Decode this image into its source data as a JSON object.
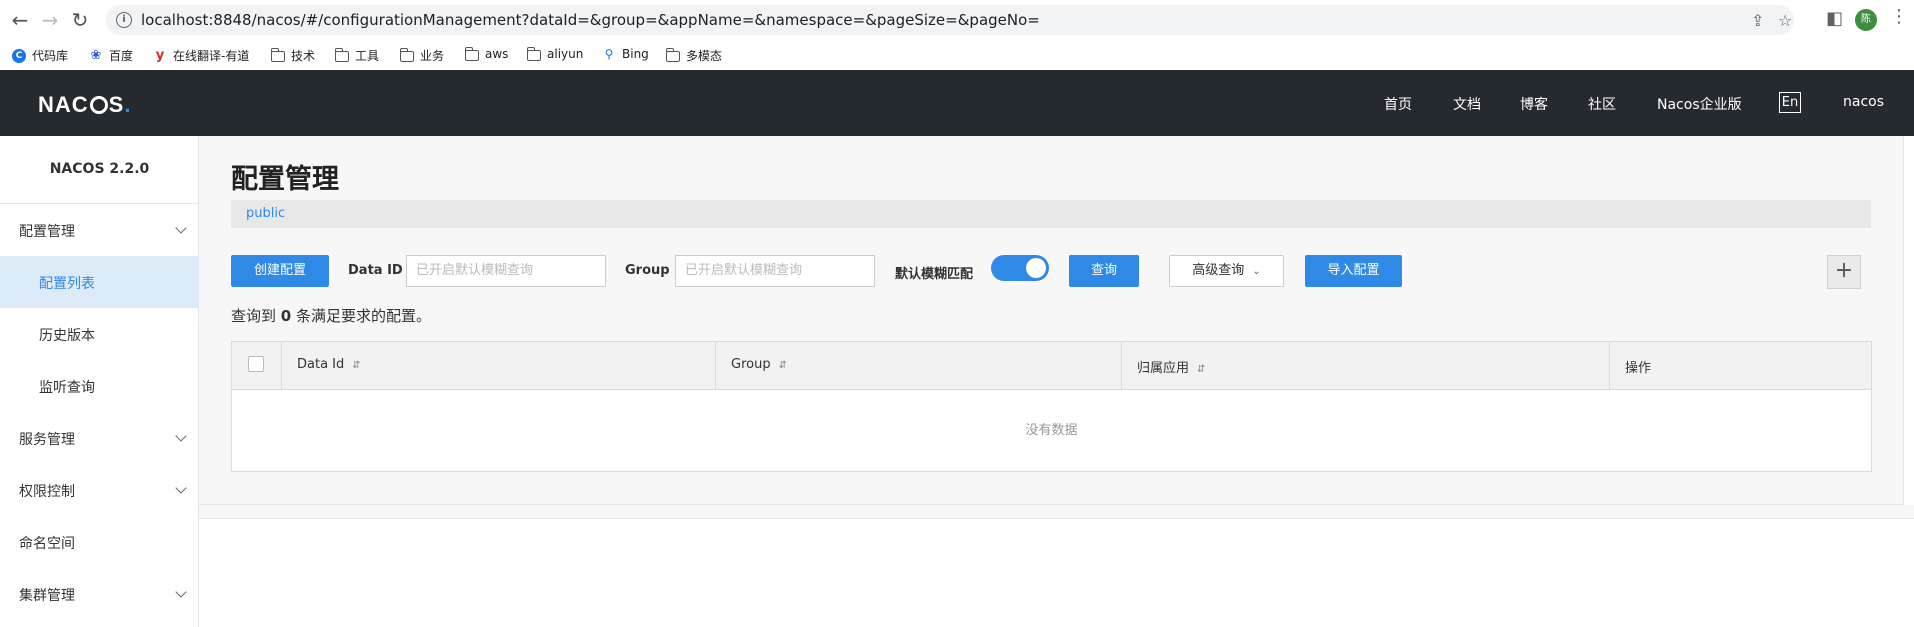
{
  "browser": {
    "url_host": "localhost",
    "url_rest": ":8848/nacos/#/configurationManagement?dataId=&group=&appName=&namespace=&pageSize=&pageNo=",
    "avatar_text": "陈",
    "bookmarks": [
      {
        "icon": "c-icon",
        "label": "代码库"
      },
      {
        "icon": "paw-icon",
        "label": "百度"
      },
      {
        "icon": "y-icon",
        "label": "在线翻译-有道"
      },
      {
        "icon": "folder-icon",
        "label": "技术"
      },
      {
        "icon": "folder-icon",
        "label": "工具"
      },
      {
        "icon": "folder-icon",
        "label": "业务"
      },
      {
        "icon": "folder-icon",
        "label": "aws"
      },
      {
        "icon": "folder-icon",
        "label": "aliyun"
      },
      {
        "icon": "search-icon",
        "label": "Bing"
      },
      {
        "icon": "folder-icon",
        "label": "多模态"
      }
    ]
  },
  "header": {
    "logo": "NACOS.",
    "nav": [
      "首页",
      "文档",
      "博客",
      "社区",
      "Nacos企业版"
    ],
    "lang": "En",
    "user": "nacos"
  },
  "sidebar": {
    "version": "NACOS 2.2.0",
    "items": [
      {
        "label": "配置管理",
        "expandable": true
      },
      {
        "label": "配置列表",
        "sub": true,
        "active": true
      },
      {
        "label": "历史版本",
        "sub": true
      },
      {
        "label": "监听查询",
        "sub": true
      },
      {
        "label": "服务管理",
        "expandable": true
      },
      {
        "label": "权限控制",
        "expandable": true
      },
      {
        "label": "命名空间"
      },
      {
        "label": "集群管理",
        "expandable": true
      }
    ]
  },
  "main": {
    "title": "配置管理",
    "namespace": "public",
    "create_button": "创建配置",
    "dataid_label": "Data ID",
    "dataid_placeholder": "已开启默认模糊查询",
    "group_label": "Group",
    "group_placeholder": "已开启默认模糊查询",
    "fuzzy_label": "默认模糊匹配",
    "fuzzy_enabled": true,
    "query_button": "查询",
    "advanced_button": "高级查询",
    "import_button": "导入配置",
    "result_prefix": "查询到",
    "result_count": "0",
    "result_suffix": "条满足要求的配置。",
    "table": {
      "columns": [
        "Data Id",
        "Group",
        "归属应用",
        "操作"
      ],
      "empty_text": "没有数据"
    }
  },
  "colors": {
    "header_bg": "#252a2f",
    "accent": "#2e8ae6",
    "active_item_bg": "#ddeaf8"
  }
}
